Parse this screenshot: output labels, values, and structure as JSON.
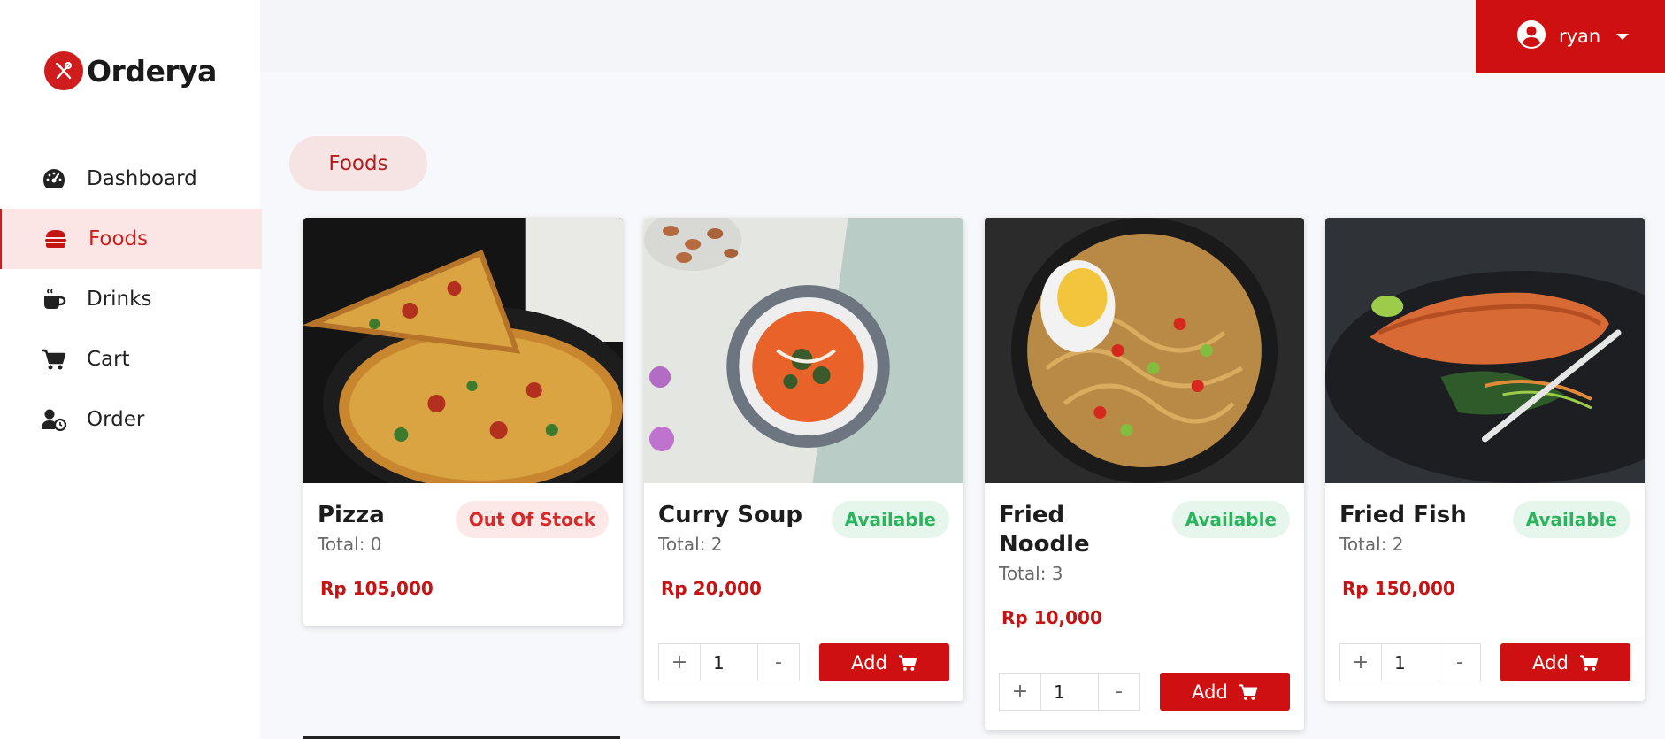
{
  "app": {
    "name": "Orderya",
    "brand_color": "#cf1010"
  },
  "sidebar": {
    "items": [
      {
        "label": "Dashboard",
        "icon": "dashboard-icon",
        "active": false
      },
      {
        "label": "Foods",
        "icon": "burger-icon",
        "active": true
      },
      {
        "label": "Drinks",
        "icon": "coffee-icon",
        "active": false
      },
      {
        "label": "Cart",
        "icon": "cart-icon",
        "active": false
      },
      {
        "label": "Order",
        "icon": "user-clock-icon",
        "active": false
      }
    ]
  },
  "header": {
    "user": {
      "name": "ryan",
      "icon": "user-circle-icon"
    }
  },
  "category": {
    "label": "Foods"
  },
  "products": [
    {
      "name": "Pizza",
      "status": "Out Of Stock",
      "total": "Total: 0",
      "price": "Rp 105,000"
    },
    {
      "name": "Curry Soup",
      "status": "Available",
      "total": "Total: 2",
      "price": "Rp 20,000",
      "qty": "1",
      "add_label": "Add",
      "plus": "+",
      "minus": "-"
    },
    {
      "name": "Fried Noodle",
      "status": "Available",
      "total": "Total: 3",
      "price": "Rp 10,000",
      "qty": "1",
      "add_label": "Add",
      "plus": "+",
      "minus": "-"
    },
    {
      "name": "Fried Fish",
      "status": "Available",
      "total": "Total: 2",
      "price": "Rp 150,000",
      "qty": "1",
      "add_label": "Add",
      "plus": "+",
      "minus": "-"
    }
  ]
}
